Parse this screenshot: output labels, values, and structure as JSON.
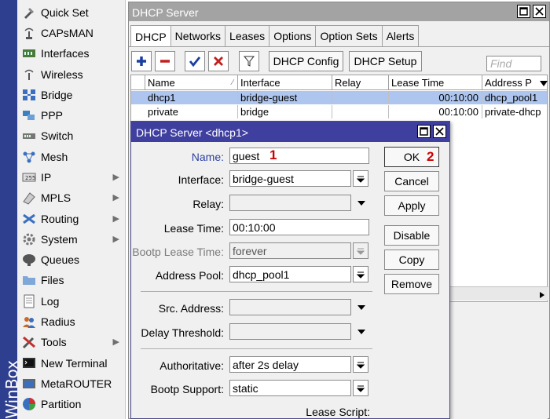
{
  "brand": "WinBox",
  "menu": {
    "items": [
      {
        "label": "Quick Set",
        "icon": "quick-set-icon",
        "sub": false
      },
      {
        "label": "CAPsMAN",
        "icon": "capsman-icon",
        "sub": false
      },
      {
        "label": "Interfaces",
        "icon": "interfaces-icon",
        "sub": false
      },
      {
        "label": "Wireless",
        "icon": "wireless-icon",
        "sub": false
      },
      {
        "label": "Bridge",
        "icon": "bridge-icon",
        "sub": false
      },
      {
        "label": "PPP",
        "icon": "ppp-icon",
        "sub": false
      },
      {
        "label": "Switch",
        "icon": "switch-icon",
        "sub": false
      },
      {
        "label": "Mesh",
        "icon": "mesh-icon",
        "sub": false
      },
      {
        "label": "IP",
        "icon": "ip-icon",
        "sub": true
      },
      {
        "label": "MPLS",
        "icon": "mpls-icon",
        "sub": true
      },
      {
        "label": "Routing",
        "icon": "routing-icon",
        "sub": true
      },
      {
        "label": "System",
        "icon": "system-gear-icon",
        "sub": true
      },
      {
        "label": "Queues",
        "icon": "queues-icon",
        "sub": false
      },
      {
        "label": "Files",
        "icon": "files-folder-icon",
        "sub": false
      },
      {
        "label": "Log",
        "icon": "log-icon",
        "sub": false
      },
      {
        "label": "Radius",
        "icon": "radius-icon",
        "sub": false
      },
      {
        "label": "Tools",
        "icon": "tools-icon",
        "sub": true
      },
      {
        "label": "New Terminal",
        "icon": "terminal-icon",
        "sub": false
      },
      {
        "label": "MetaROUTER",
        "icon": "metarouter-icon",
        "sub": false
      },
      {
        "label": "Partition",
        "icon": "partition-icon",
        "sub": false
      }
    ],
    "submenu_glyph": "▶"
  },
  "window": {
    "title": "DHCP Server",
    "tabs": [
      "DHCP",
      "Networks",
      "Leases",
      "Options",
      "Option Sets",
      "Alerts"
    ],
    "active_tab": "DHCP",
    "toolbar": {
      "dhcp_config_label": "DHCP Config",
      "dhcp_setup_label": "DHCP Setup",
      "find_placeholder": "Find"
    },
    "table": {
      "columns": [
        "Name",
        "Interface",
        "Relay",
        "Lease Time",
        "Address P"
      ],
      "rows": [
        {
          "name": "dhcp1",
          "interface": "bridge-guest",
          "relay": "",
          "lease_time": "00:10:00",
          "address_pool": "dhcp_pool1",
          "selected": true
        },
        {
          "name": "private",
          "interface": "bridge",
          "relay": "",
          "lease_time": "00:10:00",
          "address_pool": "private-dhcp",
          "selected": false
        }
      ]
    }
  },
  "dialog": {
    "title": "DHCP Server <dhcp1>",
    "fields": {
      "name_label": "Name:",
      "name_value": "guest",
      "interface_label": "Interface:",
      "interface_value": "bridge-guest",
      "relay_label": "Relay:",
      "relay_value": "",
      "lease_time_label": "Lease Time:",
      "lease_time_value": "00:10:00",
      "bootp_lease_time_label": "Bootp Lease Time:",
      "bootp_lease_time_value": "forever",
      "address_pool_label": "Address Pool:",
      "address_pool_value": "dhcp_pool1",
      "src_address_label": "Src. Address:",
      "src_address_value": "",
      "delay_threshold_label": "Delay Threshold:",
      "delay_threshold_value": "",
      "authoritative_label": "Authoritative:",
      "authoritative_value": "after 2s delay",
      "bootp_support_label": "Bootp Support:",
      "bootp_support_value": "static",
      "lease_script_label": "Lease Script:"
    },
    "buttons": {
      "ok": "OK",
      "cancel": "Cancel",
      "apply": "Apply",
      "disable": "Disable",
      "copy": "Copy",
      "remove": "Remove"
    },
    "markers": {
      "name_marker": "1",
      "ok_marker": "2"
    }
  },
  "colors": {
    "title_bar": "#a3a3a3",
    "dialog_title": "#3f3fa0",
    "selection": "#aec6ef",
    "marker": "#cc0000",
    "brand_strip": "#2e3f8f"
  }
}
